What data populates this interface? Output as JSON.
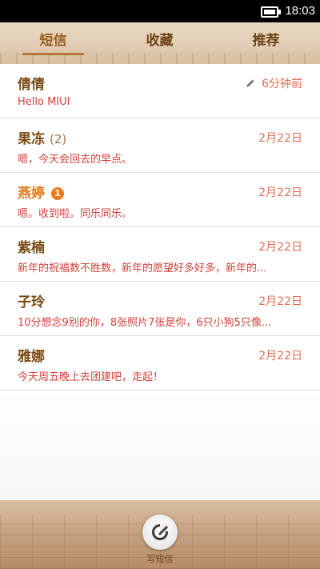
{
  "status_bar": {
    "time": "18:03"
  },
  "tabs": [
    {
      "label": "短信",
      "active": true
    },
    {
      "label": "收藏",
      "active": false
    },
    {
      "label": "推荐",
      "active": false
    }
  ],
  "conversations": [
    {
      "name": "倩倩",
      "preview": "Hello MIUI",
      "date": "6分钟前",
      "draft": true
    },
    {
      "name": "果冻",
      "count": "(2)",
      "preview": "嗯，今天会回去的早点。",
      "date": "2月22日"
    },
    {
      "name": "燕婷",
      "badge": "1",
      "preview": "嗯。收到啦。同乐同乐。",
      "date": "2月22日"
    },
    {
      "name": "紫楠",
      "preview": "新年的祝福数不胜数，新年的愿望好多好多，新年的...",
      "date": "2月22日"
    },
    {
      "name": "子玲",
      "preview": "10分想念9别的你，8张照片7张是你，6只小狗5只像...",
      "date": "2月22日"
    },
    {
      "name": "雅娜",
      "preview": "今天周五晚上去团建吧，走起！",
      "date": "2月22日"
    }
  ],
  "compose": {
    "label": "写短信",
    "icon": "compose-icon"
  },
  "colors": {
    "name": "#7a4a14",
    "unread_name": "#e07b1a",
    "preview": "#d2403a",
    "date": "#e06f55",
    "badge": "#f07a1a"
  }
}
